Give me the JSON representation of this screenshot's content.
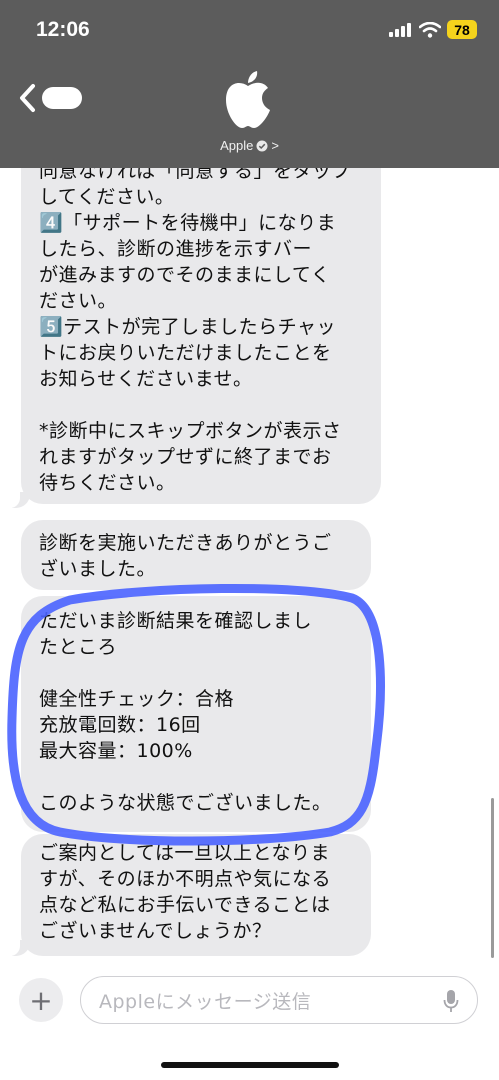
{
  "status_bar": {
    "time": "12:06",
    "battery": "78"
  },
  "header": {
    "contact_name": "Apple",
    "chevron": ">"
  },
  "messages": [
    {
      "text": "同意なければ「同意する」をタップ\nしてください。\n4️⃣「サポートを待機中」になりま\nしたら、診断の進捗を示すバー\nが進みますのでそのままにしてく\nださい。\n5️⃣テストが完了しましたらチャッ\nトにお戻りいただけましたことを\nお知らせくださいませ。\n\n*診断中にスキップボタンが表示さ\nれますがタップせずに終了までお\n待ちください。"
    },
    {
      "text": "診断を実施いただきありがとうご\nざいました。"
    },
    {
      "text": "ただいま診断結果を確認しまし\nたところ\n\n健全性チェック：合格\n充放電回数：16回\n最大容量：100%\n\nこのような状態でございました。"
    },
    {
      "text": "ご案内としては一旦以上となりま\nすが、そのほか不明点や気になる\n点など私にお手伝いできることは\nございませんでしょうか？"
    }
  ],
  "input": {
    "placeholder": "Appleにメッセージ送信",
    "add_label": "+"
  },
  "colors": {
    "header_bg": "#5c5c5c",
    "bubble_bg": "#e9e9eb",
    "highlight": "#4a63ff",
    "battery": "#f5d31c"
  }
}
